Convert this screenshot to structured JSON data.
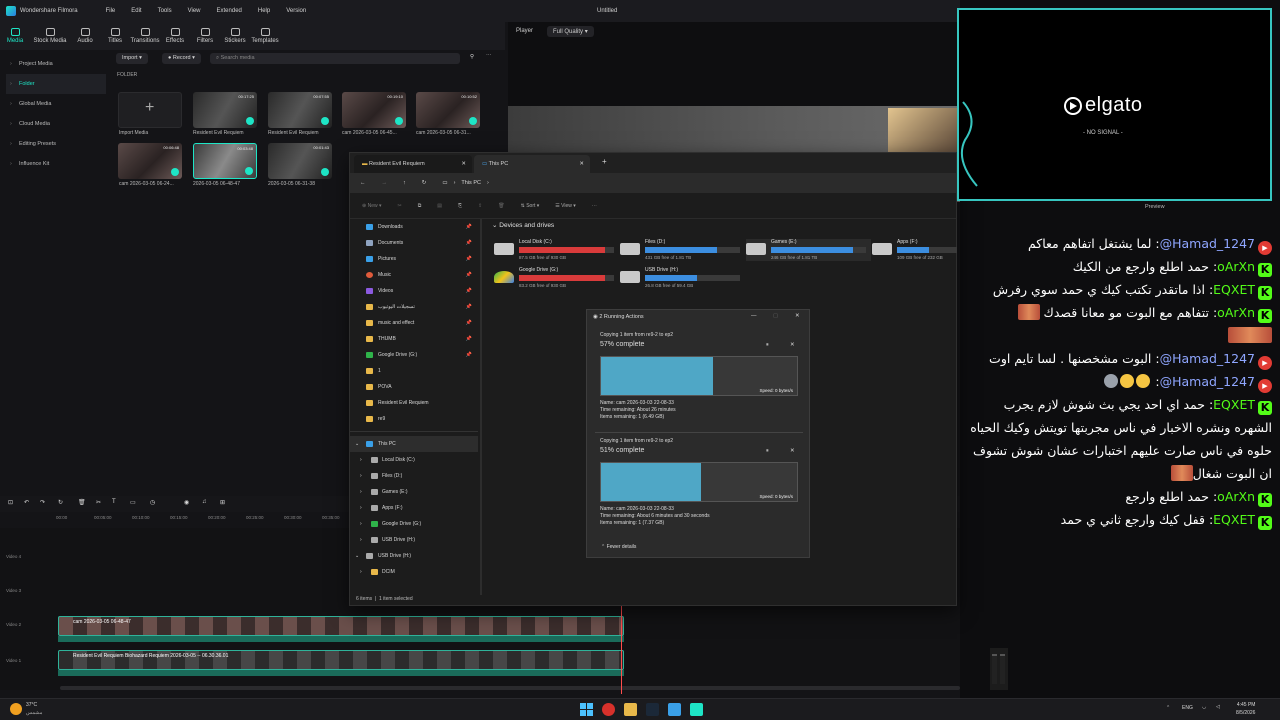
{
  "filmora": {
    "app_name": "Wondershare Filmora",
    "menu": [
      "File",
      "Edit",
      "Tools",
      "View",
      "Extended",
      "Help",
      "Version"
    ],
    "project_title": "Untitled",
    "toolbar": [
      "Media",
      "Stock Media",
      "Audio",
      "Titles",
      "Transitions",
      "Effects",
      "Filters",
      "Stickers",
      "Templates"
    ],
    "sidebar": [
      "Project Media",
      "Folder",
      "Global Media",
      "Cloud Media",
      "Editing Presets",
      "Influence Kit"
    ],
    "import_label": "Import",
    "record_label": "Record",
    "search_placeholder": "Search media",
    "folder_label": "FOLDER",
    "media": [
      {
        "label": "Import Media",
        "duration": ""
      },
      {
        "label": "Resident Evil Requiem",
        "duration": "00:17:25"
      },
      {
        "label": "Resident Evil Requiem",
        "duration": "00:07:55"
      },
      {
        "label": "cam 2026-03-05 06-45...",
        "duration": "00:19:10"
      },
      {
        "label": "cam 2026-03-05 06-31...",
        "duration": "00:10:52"
      },
      {
        "label": "cam 2026-03-05 06-24...",
        "duration": "00:06:48"
      },
      {
        "label": "2026-03-05 06-48-47",
        "duration": "00:03:48"
      },
      {
        "label": "2026-03-05 06-31-38",
        "duration": "00:01:43"
      }
    ],
    "player_label": "Player",
    "quality": "Full Quality",
    "preview_label": "Preview",
    "ruler": [
      "00:00",
      "00:05:00",
      "00:10:00",
      "00:15:00",
      "00:20:00",
      "00:25:00",
      "00:30:00",
      "00:35:00"
    ],
    "tracks": [
      "Video 4",
      "Video 3",
      "Video 2",
      "Video 1"
    ],
    "clip1": "cam 2026-03-05 06-48-47",
    "clip2": "Resident Evil Requiem Biohazard Requiem 2026-03-05 -- 06.30.36.01"
  },
  "explorer": {
    "tab1": "Resident Evil Requiem",
    "tab2": "This PC",
    "address": "This PC",
    "cmd_new": "New",
    "cmd_sort": "Sort",
    "cmd_view": "View",
    "section_title": "Devices and drives",
    "quick": [
      "Downloads",
      "Documents",
      "Pictures",
      "Music",
      "Videos",
      "تسجيلات اليوتيوب",
      "music and effect",
      "THUMB",
      "Google Drive (G:)",
      "1",
      "POVA",
      "Resident Evil Requiem",
      "re9"
    ],
    "tree": [
      "This PC",
      "Local Disk (C:)",
      "Files (D:)",
      "Games (E:)",
      "Apps (F:)",
      "Google Drive (G:)",
      "USB Drive (H:)",
      "USB Drive (H:)",
      "DCIM"
    ],
    "drives": [
      {
        "name": "Local Disk (C:)",
        "free": "87.5 GB free of 930 GB",
        "used_pct": 90,
        "color": "#d93b3b"
      },
      {
        "name": "Files (D:)",
        "free": "431 GB free of 1.81 TB",
        "used_pct": 76,
        "color": "#3c8ee0"
      },
      {
        "name": "Games (E:)",
        "free": "246 GB free of 1.81 TB",
        "used_pct": 86,
        "color": "#3c8ee0"
      },
      {
        "name": "Apps (F:)",
        "free": "109 GB free of 232 GB",
        "used_pct": 53,
        "color": "#3c8ee0"
      },
      {
        "name": "Google Drive (G:)",
        "free": "83.2 GB free of 930 GB",
        "used_pct": 91,
        "color": "#d93b3b"
      },
      {
        "name": "USB Drive (H:)",
        "free": "26.8 GB free of 59.4 GB",
        "used_pct": 55,
        "color": "#3c8ee0"
      }
    ],
    "status": "6 items",
    "status_sel": "1 item selected"
  },
  "copy": {
    "title": "2 Running Actions",
    "items": [
      {
        "copying": "Copying 1 item from re9-2 to ep2",
        "pct_text": "57% complete",
        "pct": 57,
        "speed": "Speed: 0 bytes/s",
        "name": "Name: cam 2026-03-03 22-08-33",
        "remaining": "Time remaining: About 26 minutes",
        "items_remaining": "Items remaining: 1 (6.49 GB)"
      },
      {
        "copying": "Copying 1 item from re9-2 to ep2",
        "pct_text": "51% complete",
        "pct": 51,
        "speed": "Speed: 0 bytes/s",
        "name": "Name: cam 2026-03-03 22-08-33",
        "remaining": "Time remaining: About 6 minutes and 30 seconds",
        "items_remaining": "Items remaining: 1 (7.37 GB)"
      }
    ],
    "fewer": "Fewer details"
  },
  "elgato": {
    "brand": "elgato",
    "status": "- NO SIGNAL -"
  },
  "chat": [
    {
      "platform": "yt",
      "user": "@Hamad_1247",
      "text": "لما يشتغل اتفاهم معاكم",
      "emotes": ""
    },
    {
      "platform": "kick",
      "user": "oArXn",
      "text": "حمد اطلع وارجع من الكيك",
      "emotes": ""
    },
    {
      "platform": "kick",
      "user": "EQXET",
      "text": "اذا ماتقدر تكتب كيك ي حمد سوي رفرش",
      "emotes": ""
    },
    {
      "platform": "kick",
      "user": "oArXn",
      "text": "تتفاهم مع البوت مو معانا قصدك",
      "emotes": "emote2"
    },
    {
      "platform": "yt",
      "user": "@Hamad_1247",
      "text": "البوت مشخصنها . لسا تايم اوت",
      "emotes": ""
    },
    {
      "platform": "yt",
      "user": "@Hamad_1247",
      "text": "",
      "emotes": "emoji3"
    },
    {
      "platform": "kick",
      "user": "EQXET",
      "text": "حمد اي احد يجي بث شوش لازم يجرب الشهره ونشره الاخبار في ناس مجربتها تويتش وكيك الحياه حلوه في ناس صارت عليهم اختبارات عشان شوش تشوف ان البوت شغال",
      "emotes": "emote1"
    },
    {
      "platform": "kick",
      "user": "oArXn",
      "text": "حمد اطلع وارجع",
      "emotes": ""
    },
    {
      "platform": "kick",
      "user": "EQXET",
      "text": "قفل كيك وارجع ثاني ي حمد",
      "emotes": ""
    }
  ],
  "taskbar": {
    "temp": "37°C",
    "weather": "مشمس",
    "lang": "ENG",
    "time": "4:45 PM",
    "date": "8/5/2026"
  },
  "colors": {
    "accent": "#1ee5c6",
    "elgato_border": "#37c6c0",
    "kick": "#53fc18",
    "youtube": "#e23b34",
    "progress": "#4fa7c6"
  }
}
